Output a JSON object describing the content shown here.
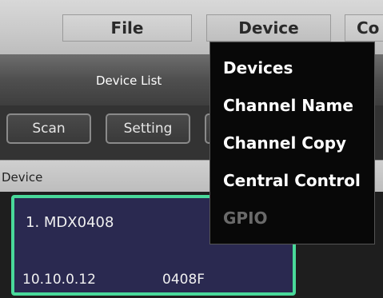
{
  "menubar": {
    "file": "File",
    "device": "Device",
    "co": "Co"
  },
  "panel": {
    "title": "Device List"
  },
  "toolbar": {
    "scan": "Scan",
    "setting": "Setting"
  },
  "list": {
    "column_header": "Device",
    "devices": [
      {
        "name": "1. MDX0408",
        "ip": "10.10.0.12",
        "id": "0408F"
      }
    ]
  },
  "dropdown": {
    "items": [
      {
        "label": "Devices",
        "enabled": true
      },
      {
        "label": "Channel Name",
        "enabled": true
      },
      {
        "label": "Channel Copy",
        "enabled": true
      },
      {
        "label": "Central Control",
        "enabled": true
      },
      {
        "label": "GPIO",
        "enabled": false
      }
    ]
  },
  "colors": {
    "card_border": "#49d99a",
    "card_bg": "#2a2950",
    "menu_bg": "#080808",
    "disabled_text": "#6a6a6a"
  }
}
